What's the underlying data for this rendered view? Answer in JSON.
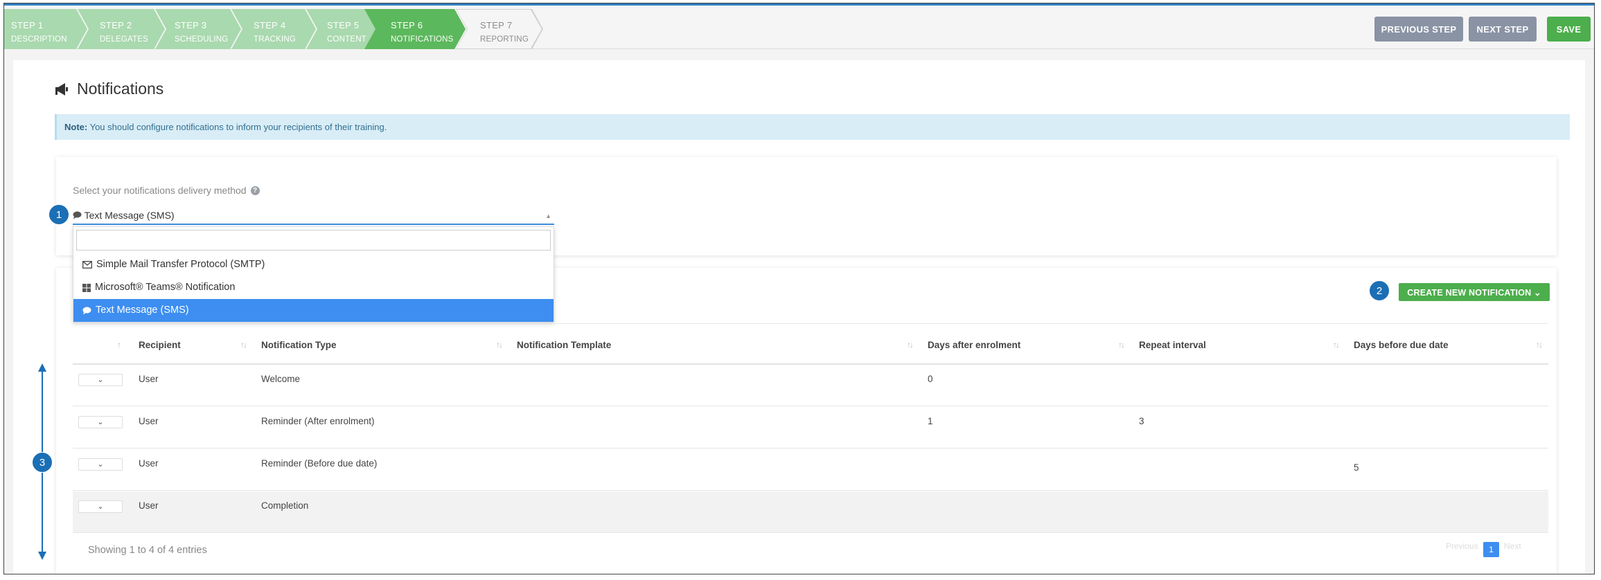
{
  "wizard": {
    "steps": [
      {
        "num": "STEP 1",
        "label": "DESCRIPTION"
      },
      {
        "num": "STEP 2",
        "label": "DELEGATES"
      },
      {
        "num": "STEP 3",
        "label": "SCHEDULING"
      },
      {
        "num": "STEP 4",
        "label": "TRACKING"
      },
      {
        "num": "STEP 5",
        "label": "CONTENT"
      },
      {
        "num": "STEP 6",
        "label": "NOTIFICATIONS"
      },
      {
        "num": "STEP 7",
        "label": "REPORTING"
      }
    ],
    "previous_label": "PREVIOUS STEP",
    "next_label": "NEXT STEP",
    "save_label": "SAVE"
  },
  "page": {
    "title": "Notifications",
    "note_prefix": "Note:",
    "note_text": " You should configure notifications to inform your recipients of their training."
  },
  "delivery": {
    "label": "Select your notifications delivery method",
    "help_glyph": "?",
    "selected": "Text Message (SMS)",
    "options": [
      "Simple Mail Transfer Protocol (SMTP)",
      "Microsoft® Teams® Notification",
      "Text Message (SMS)"
    ],
    "search_placeholder": ""
  },
  "create_button_label": "CREATE NEW NOTIFICATION ⌄",
  "table": {
    "headers": [
      "Recipient",
      "Notification Type",
      "Notification Template",
      "Days after enrolment",
      "Repeat interval",
      "Days before due date"
    ],
    "rows": [
      {
        "recipient": "User",
        "type": "Welcome",
        "template": "",
        "days_after": "0",
        "repeat": "",
        "days_before": ""
      },
      {
        "recipient": "User",
        "type": "Reminder (After enrolment)",
        "template": "",
        "days_after": "1",
        "repeat": "3",
        "days_before": ""
      },
      {
        "recipient": "User",
        "type": "Reminder (Before due date)",
        "template": "",
        "days_after": "",
        "repeat": "",
        "days_before": "5"
      },
      {
        "recipient": "User",
        "type": "Completion",
        "template": "",
        "days_after": "",
        "repeat": "",
        "days_before": ""
      }
    ],
    "expand_glyph": "⌄",
    "showing": "Showing 1 to 4 of 4 entries",
    "pager": {
      "previous": "Previous",
      "current": "1",
      "next": "Next"
    }
  },
  "callouts": [
    "1",
    "2",
    "3"
  ],
  "colors": {
    "accent": "#3d8ef0",
    "step_active": "#5cb85c",
    "step_done": "#a9d9ae",
    "callout": "#1b6fb5"
  }
}
